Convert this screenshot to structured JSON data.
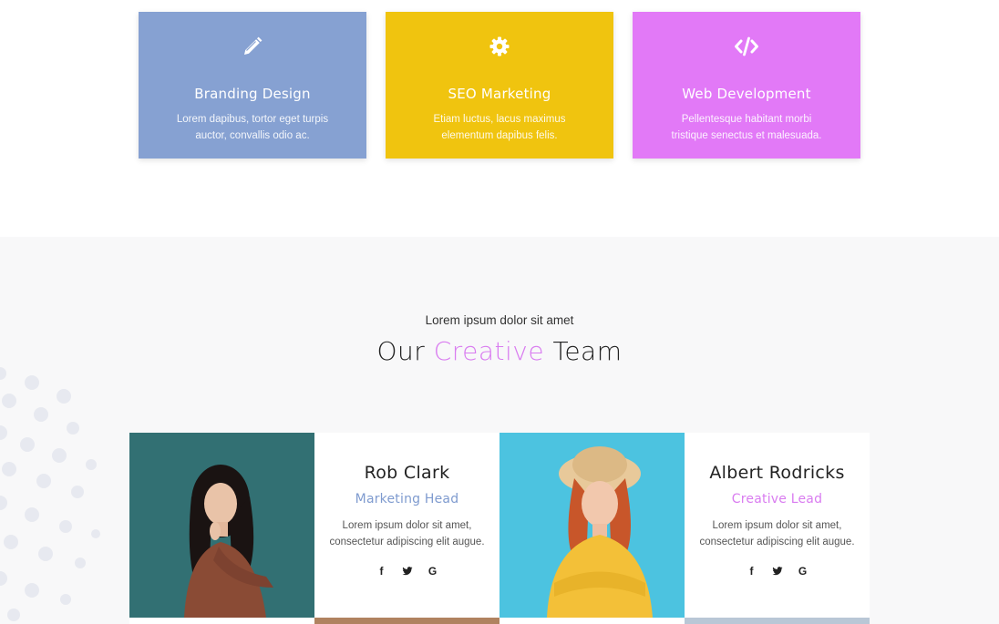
{
  "services": {
    "cards": [
      {
        "icon": "pencil-icon",
        "title": "Branding Design",
        "text": "Lorem dapibus, tortor eget turpis auctor, convallis odio ac.",
        "color": "#86a1d2"
      },
      {
        "icon": "gear-icon",
        "title": "SEO Marketing",
        "text": "Etiam luctus, lacus maximus elementum dapibus felis.",
        "color": "#f0c40f"
      },
      {
        "icon": "code-icon",
        "title": "Web Development",
        "text": "Pellentesque habitant morbi tristique senectus et malesuada.",
        "color": "#e279f7"
      }
    ]
  },
  "team": {
    "kicker": "Lorem ipsum dolor sit amet",
    "heading_before": "Our",
    "heading_accent": "Creative",
    "heading_after": "Team",
    "accent_color": "#d97cf0",
    "members": [
      {
        "name": "Rob Clark",
        "role": "Marketing Head",
        "role_color": "#7f9bcf",
        "bio": "Lorem ipsum dolor sit amet, consectetur adipiscing elit augue.",
        "social": [
          "f",
          "t",
          "G"
        ]
      },
      {
        "name": "Albert Rodricks",
        "role": "Creative Lead",
        "role_color": "#d97cf0",
        "bio": "Lorem ipsum dolor sit amet, consectetur adipiscing elit augue.",
        "social": [
          "f",
          "t",
          "G"
        ]
      }
    ],
    "social_icons": [
      "facebook-icon",
      "twitter-icon",
      "google-icon"
    ]
  }
}
